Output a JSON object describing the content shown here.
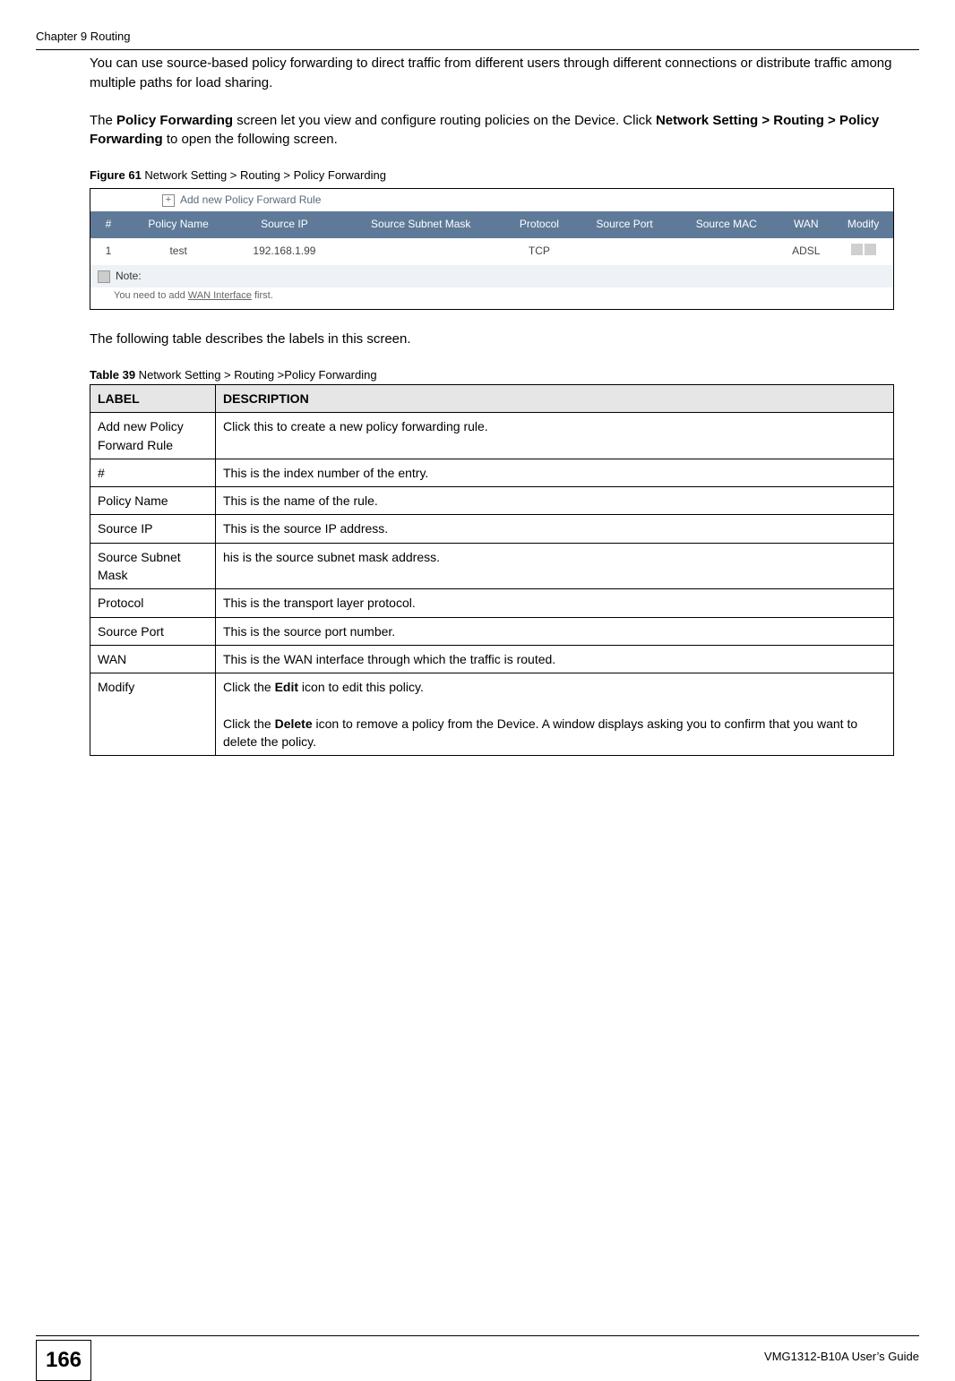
{
  "header": {
    "chapter": "Chapter 9 Routing"
  },
  "body": {
    "p1": "You can use source-based policy forwarding to direct traffic from different users through different connections or distribute traffic among multiple paths for load sharing.",
    "p2a": "The ",
    "p2b": "Policy Forwarding",
    "p2c": " screen let you view and configure routing policies on the Device. Click ",
    "p2d": "Network Setting > Routing > Policy Forwarding",
    "p2e": " to open the following screen.",
    "fig_label": "Figure 61",
    "fig_caption": "   Network Setting > Routing > Policy Forwarding",
    "screenshot": {
      "add_label": "Add new Policy Forward Rule",
      "headers": [
        "#",
        "Policy Name",
        "Source IP",
        "Source Subnet Mask",
        "Protocol",
        "Source Port",
        "Source MAC",
        "WAN",
        "Modify"
      ],
      "row": {
        "num": "1",
        "name": "test",
        "sip": "192.168.1.99",
        "mask": "",
        "proto": "TCP",
        "sport": "",
        "smac": "",
        "wan": "ADSL"
      },
      "note_label": "Note:",
      "note_text_a": "You need to add ",
      "note_text_link": "WAN Interface",
      "note_text_b": " first."
    },
    "p3": "The following table describes the labels in this screen.",
    "tab_label": "Table 39",
    "tab_caption": "   Network Setting > Routing >Policy Forwarding",
    "table": {
      "h_label": "LABEL",
      "h_desc": "DESCRIPTION",
      "rows": [
        {
          "label": "Add new Policy Forward Rule",
          "desc": "Click this to create a new policy forwarding rule."
        },
        {
          "label": "#",
          "desc": "This is the index number of the entry."
        },
        {
          "label": "Policy Name",
          "desc": "This is the name of the rule."
        },
        {
          "label": "Source IP",
          "desc": "This is the source IP address."
        },
        {
          "label": "Source Subnet Mask",
          "desc": "his is the source subnet mask address."
        },
        {
          "label": "Protocol",
          "desc": "This is the transport layer protocol."
        },
        {
          "label": "Source Port",
          "desc": "This is the source port number."
        },
        {
          "label": "WAN",
          "desc": "This is the WAN interface through which the traffic is routed."
        }
      ],
      "modify_label": "Modify",
      "modify_p1a": "Click the ",
      "modify_p1b": "Edit",
      "modify_p1c": " icon to edit this policy.",
      "modify_p2a": "Click the ",
      "modify_p2b": "Delete",
      "modify_p2c": " icon to remove a policy from the Device. A window displays asking you to confirm that you want to delete the policy."
    }
  },
  "footer": {
    "pagenum": "166",
    "guide": "VMG1312-B10A User’s Guide"
  }
}
